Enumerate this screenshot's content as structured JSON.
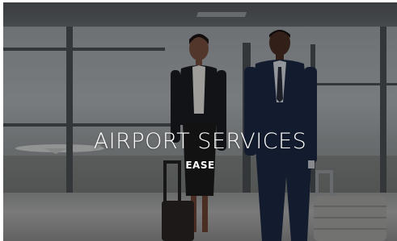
{
  "hero": {
    "title": "AIRPORT SERVICES",
    "subtitle": "EASE"
  },
  "image": {
    "icon": "airport-travelers-photo"
  }
}
